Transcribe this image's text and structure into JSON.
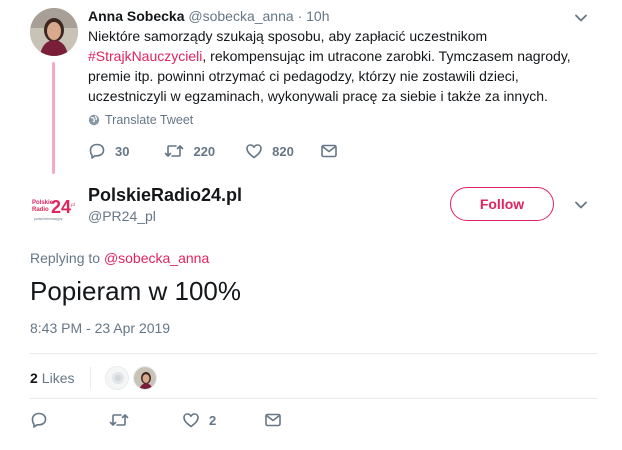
{
  "parent_tweet": {
    "author_name": "Anna Sobecka",
    "author_handle": "@sobecka_anna",
    "separator": "·",
    "time": "10h",
    "text_part1": "Niektóre samorządy szukają sposobu, aby zapłacić uczestnikom ",
    "hashtag": "#StrajkNauczycieli",
    "text_part2": ", rekompensując im utracone zarobki. Tymczasem nagrody, premie itp. powinni otrzymać ci pedagodzy, którzy nie zostawili dzieci, uczestniczyli w egzaminach, wykonywali pracę za siebie i także za innych.",
    "translate_label": "Translate Tweet",
    "replies": "30",
    "retweets": "220",
    "likes": "820"
  },
  "main_tweet": {
    "author_name": "PolskieRadio24.pl",
    "author_handle": "@PR24_pl",
    "follow_label": "Follow",
    "replying_prefix": "Replying to ",
    "replying_handle": "@sobecka_anna",
    "text": "Popieram w 100%",
    "timestamp": "8:43 PM - 23 Apr 2019",
    "likes_count": "2",
    "likes_label": "Likes",
    "action_likes": "2"
  },
  "logo": {
    "small_top": "Polskie",
    "small_bottom": "Radio",
    "number": "24",
    "suffix": ".pl",
    "tagline": "portal informacyjny"
  },
  "colors": {
    "accent": "#e0245e",
    "thread_line": "#f4a8c4",
    "secondary_text": "#657786",
    "primary_text": "#14171a",
    "divider": "#e6ecf0"
  }
}
